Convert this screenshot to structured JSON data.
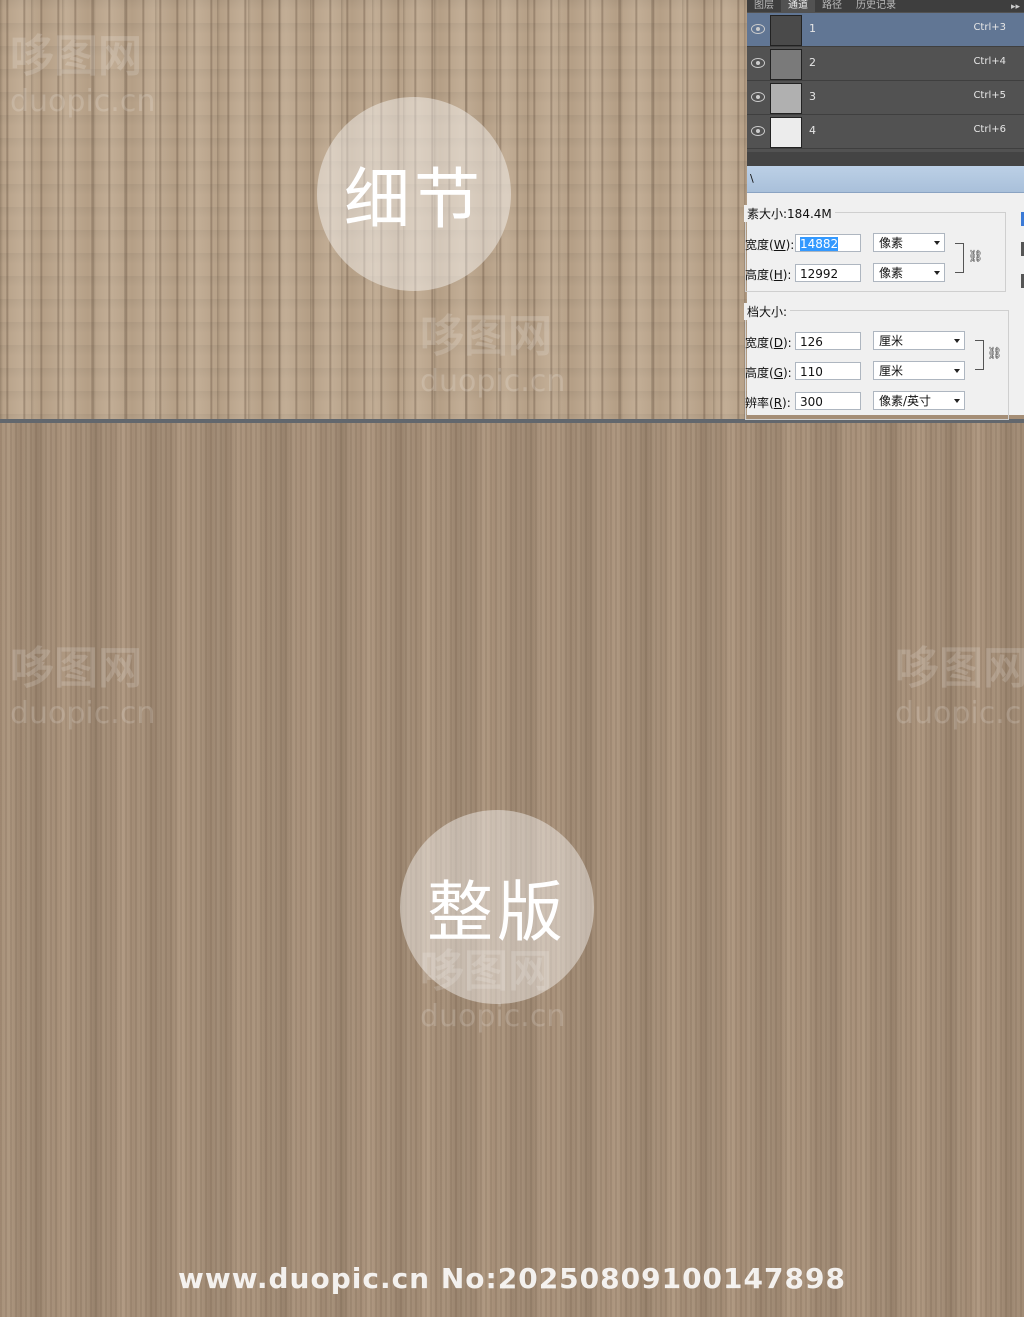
{
  "panels": {
    "detail_label": "细节",
    "full_label": "整版"
  },
  "footer": {
    "text": "www.duopic.cn No:20250809100147898"
  },
  "watermark": {
    "cn": "哆图网",
    "en": "duopic.cn"
  },
  "layers_panel": {
    "tabs": [
      "图层",
      "通道",
      "路径",
      "历史记录"
    ],
    "active_tab": "通道",
    "menu_glyph": "▸▸",
    "channels": [
      {
        "name": "1",
        "shortcut": "Ctrl+3",
        "selected": true,
        "thumb": "#4a4a4a"
      },
      {
        "name": "2",
        "shortcut": "Ctrl+4",
        "selected": false,
        "thumb": "#7a7a7a"
      },
      {
        "name": "3",
        "shortcut": "Ctrl+5",
        "selected": false,
        "thumb": "#b0b0b0"
      },
      {
        "name": "4",
        "shortcut": "Ctrl+6",
        "selected": false,
        "thumb": "#ececec"
      }
    ]
  },
  "image_size_dialog": {
    "title_glyph": "\\",
    "pixel_dim_label": "素大小:184.4M",
    "width_label": "宽度(",
    "width_key": "W",
    "width_value": "14882",
    "width_unit": "像素",
    "height_label": "高度(",
    "height_key": "H",
    "height_value": "12992",
    "height_unit": "像素",
    "doc_size_label": "档大小:",
    "doc_width_label": "宽度(",
    "doc_width_key": "D",
    "doc_width_value": "126",
    "doc_width_unit": "厘米",
    "doc_height_label": "高度(",
    "doc_height_key": "G",
    "doc_height_value": "110",
    "doc_height_unit": "厘米",
    "res_label": "辨率(",
    "res_key": "R",
    "res_value": "300",
    "res_unit": "像素/英寸",
    "label_close": "):"
  }
}
